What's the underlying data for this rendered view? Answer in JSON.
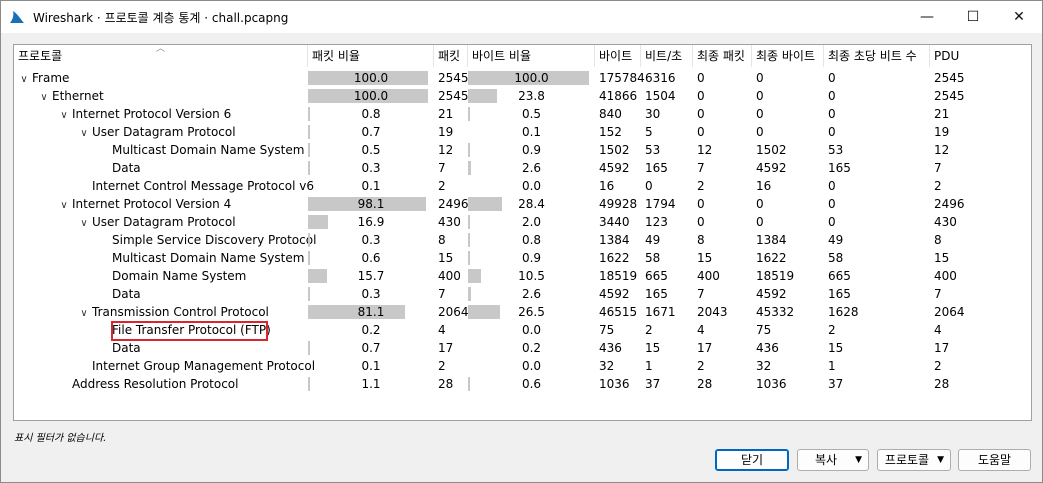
{
  "window": {
    "title": "Wireshark · 프로토콜 계층 통계 · chall.pcapng",
    "minimize_glyph": "—",
    "maximize_glyph": "☐",
    "close_glyph": "✕"
  },
  "columns": [
    "프로토콜",
    "패킷 비율",
    "패킷",
    "바이트 비율",
    "바이트",
    "비트/초",
    "최종 패킷",
    "최종 바이트",
    "최종 초당 비트 수",
    "PDU"
  ],
  "rows": [
    {
      "depth": 0,
      "expand": true,
      "protocol": "Frame",
      "pkt_pct": "100.0",
      "pkt_bar": 100.0,
      "packets": "2545",
      "byte_pct": "100.0",
      "byte_bar": 100.0,
      "bytes": "175784",
      "bps": "6316",
      "end_pkts": "0",
      "end_bytes": "0",
      "end_bps": "0",
      "pdus": "2545"
    },
    {
      "depth": 1,
      "expand": true,
      "protocol": "Ethernet",
      "pkt_pct": "100.0",
      "pkt_bar": 100.0,
      "packets": "2545",
      "byte_pct": "23.8",
      "byte_bar": 23.8,
      "bytes": "41866",
      "bps": "1504",
      "end_pkts": "0",
      "end_bytes": "0",
      "end_bps": "0",
      "pdus": "2545"
    },
    {
      "depth": 2,
      "expand": true,
      "protocol": "Internet Protocol Version 6",
      "pkt_pct": "0.8",
      "pkt_bar": 0.8,
      "packets": "21",
      "byte_pct": "0.5",
      "byte_bar": 0.5,
      "bytes": "840",
      "bps": "30",
      "end_pkts": "0",
      "end_bytes": "0",
      "end_bps": "0",
      "pdus": "21"
    },
    {
      "depth": 3,
      "expand": true,
      "protocol": "User Datagram Protocol",
      "pkt_pct": "0.7",
      "pkt_bar": 0.7,
      "packets": "19",
      "byte_pct": "0.1",
      "byte_bar": 0.1,
      "bytes": "152",
      "bps": "5",
      "end_pkts": "0",
      "end_bytes": "0",
      "end_bps": "0",
      "pdus": "19"
    },
    {
      "depth": 4,
      "expand": false,
      "protocol": "Multicast Domain Name System",
      "pkt_pct": "0.5",
      "pkt_bar": 0.5,
      "packets": "12",
      "byte_pct": "0.9",
      "byte_bar": 0.9,
      "bytes": "1502",
      "bps": "53",
      "end_pkts": "12",
      "end_bytes": "1502",
      "end_bps": "53",
      "pdus": "12"
    },
    {
      "depth": 4,
      "expand": false,
      "protocol": "Data",
      "pkt_pct": "0.3",
      "pkt_bar": 0.3,
      "packets": "7",
      "byte_pct": "2.6",
      "byte_bar": 2.6,
      "bytes": "4592",
      "bps": "165",
      "end_pkts": "7",
      "end_bytes": "4592",
      "end_bps": "165",
      "pdus": "7"
    },
    {
      "depth": 3,
      "expand": false,
      "protocol": "Internet Control Message Protocol v6",
      "pkt_pct": "0.1",
      "pkt_bar": 0.1,
      "packets": "2",
      "byte_pct": "0.0",
      "byte_bar": 0.0,
      "bytes": "16",
      "bps": "0",
      "end_pkts": "2",
      "end_bytes": "16",
      "end_bps": "0",
      "pdus": "2"
    },
    {
      "depth": 2,
      "expand": true,
      "protocol": "Internet Protocol Version 4",
      "pkt_pct": "98.1",
      "pkt_bar": 98.1,
      "packets": "2496",
      "byte_pct": "28.4",
      "byte_bar": 28.4,
      "bytes": "49928",
      "bps": "1794",
      "end_pkts": "0",
      "end_bytes": "0",
      "end_bps": "0",
      "pdus": "2496"
    },
    {
      "depth": 3,
      "expand": true,
      "protocol": "User Datagram Protocol",
      "pkt_pct": "16.9",
      "pkt_bar": 16.9,
      "packets": "430",
      "byte_pct": "2.0",
      "byte_bar": 2.0,
      "bytes": "3440",
      "bps": "123",
      "end_pkts": "0",
      "end_bytes": "0",
      "end_bps": "0",
      "pdus": "430"
    },
    {
      "depth": 4,
      "expand": false,
      "protocol": "Simple Service Discovery Protocol",
      "pkt_pct": "0.3",
      "pkt_bar": 0.3,
      "packets": "8",
      "byte_pct": "0.8",
      "byte_bar": 0.8,
      "bytes": "1384",
      "bps": "49",
      "end_pkts": "8",
      "end_bytes": "1384",
      "end_bps": "49",
      "pdus": "8"
    },
    {
      "depth": 4,
      "expand": false,
      "protocol": "Multicast Domain Name System",
      "pkt_pct": "0.6",
      "pkt_bar": 0.6,
      "packets": "15",
      "byte_pct": "0.9",
      "byte_bar": 0.9,
      "bytes": "1622",
      "bps": "58",
      "end_pkts": "15",
      "end_bytes": "1622",
      "end_bps": "58",
      "pdus": "15"
    },
    {
      "depth": 4,
      "expand": false,
      "protocol": "Domain Name System",
      "pkt_pct": "15.7",
      "pkt_bar": 15.7,
      "packets": "400",
      "byte_pct": "10.5",
      "byte_bar": 10.5,
      "bytes": "18519",
      "bps": "665",
      "end_pkts": "400",
      "end_bytes": "18519",
      "end_bps": "665",
      "pdus": "400"
    },
    {
      "depth": 4,
      "expand": false,
      "protocol": "Data",
      "pkt_pct": "0.3",
      "pkt_bar": 0.3,
      "packets": "7",
      "byte_pct": "2.6",
      "byte_bar": 2.6,
      "bytes": "4592",
      "bps": "165",
      "end_pkts": "7",
      "end_bytes": "4592",
      "end_bps": "165",
      "pdus": "7"
    },
    {
      "depth": 3,
      "expand": true,
      "protocol": "Transmission Control Protocol",
      "pkt_pct": "81.1",
      "pkt_bar": 81.1,
      "packets": "2064",
      "byte_pct": "26.5",
      "byte_bar": 26.5,
      "bytes": "46515",
      "bps": "1671",
      "end_pkts": "2043",
      "end_bytes": "45332",
      "end_bps": "1628",
      "pdus": "2064"
    },
    {
      "depth": 4,
      "expand": false,
      "protocol": "File Transfer Protocol (FTP)",
      "pkt_pct": "0.2",
      "pkt_bar": 0.2,
      "packets": "4",
      "byte_pct": "0.0",
      "byte_bar": 0.0,
      "bytes": "75",
      "bps": "2",
      "end_pkts": "4",
      "end_bytes": "75",
      "end_bps": "2",
      "pdus": "4",
      "highlight": true
    },
    {
      "depth": 4,
      "expand": false,
      "protocol": "Data",
      "pkt_pct": "0.7",
      "pkt_bar": 0.7,
      "packets": "17",
      "byte_pct": "0.2",
      "byte_bar": 0.2,
      "bytes": "436",
      "bps": "15",
      "end_pkts": "17",
      "end_bytes": "436",
      "end_bps": "15",
      "pdus": "17"
    },
    {
      "depth": 3,
      "expand": false,
      "protocol": "Internet Group Management Protocol",
      "pkt_pct": "0.1",
      "pkt_bar": 0.1,
      "packets": "2",
      "byte_pct": "0.0",
      "byte_bar": 0.0,
      "bytes": "32",
      "bps": "1",
      "end_pkts": "2",
      "end_bytes": "32",
      "end_bps": "1",
      "pdus": "2"
    },
    {
      "depth": 2,
      "expand": false,
      "protocol": "Address Resolution Protocol",
      "pkt_pct": "1.1",
      "pkt_bar": 1.1,
      "packets": "28",
      "byte_pct": "0.6",
      "byte_bar": 0.6,
      "bytes": "1036",
      "bps": "37",
      "end_pkts": "28",
      "end_bytes": "1036",
      "end_bps": "37",
      "pdus": "28"
    }
  ],
  "status": "표시 필터가 없습니다.",
  "buttons": {
    "close": "닫기",
    "copy": "복사",
    "protocol": "프로토콜",
    "help": "도움말"
  },
  "colors": {
    "bar": "#c8c8c8",
    "highlight_box": "#d9262c",
    "primary_button_border": "#0067c0"
  }
}
